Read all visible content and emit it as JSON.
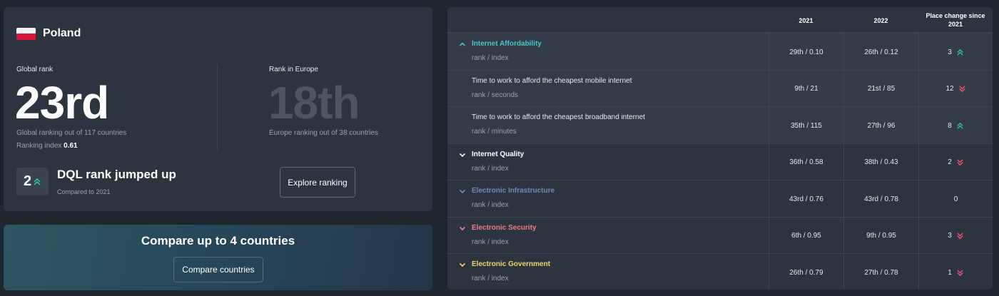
{
  "country": {
    "name": "Poland"
  },
  "global": {
    "label": "Global rank",
    "rank": "23rd",
    "sub": "Global ranking out of 117 countries",
    "index_label": "Ranking index",
    "index_value": "0.61"
  },
  "europe": {
    "label": "Rank in Europe",
    "rank": "18th",
    "sub": "Europe ranking out of 38 countries"
  },
  "jump": {
    "value": "2",
    "title": "DQL rank jumped up",
    "sub": "Compared to 2021",
    "explore_label": "Explore ranking"
  },
  "compare": {
    "title": "Compare up to 4 countries",
    "button_label": "Compare countries"
  },
  "colors": {
    "up": "#2fc28a",
    "down": "#f0506e",
    "affordability": "#4fc3c8",
    "quality": "#ffffff",
    "infrastructure": "#6f8bb5",
    "security": "#f07a8a",
    "government": "#f2d56a"
  },
  "table": {
    "headers": {
      "y2021": "2021",
      "y2022": "2022",
      "change": "Place change since 2021"
    },
    "rows": [
      {
        "name": "Internet Affordability",
        "sub": "rank / index",
        "v2021": "29th / 0.10",
        "v2022": "26th / 0.12",
        "change": "3",
        "dir": "up",
        "category": true,
        "color": "#4fc3c8",
        "chev": "up",
        "highlight": true
      },
      {
        "name": "Time to work to afford the cheapest mobile internet",
        "sub": "rank / seconds",
        "v2021": "9th / 21",
        "v2022": "21st / 85",
        "change": "12",
        "dir": "down",
        "category": false,
        "highlight": true
      },
      {
        "name": "Time to work to afford the cheapest broadband internet",
        "sub": "rank / minutes",
        "v2021": "35th / 115",
        "v2022": "27th / 96",
        "change": "8",
        "dir": "up",
        "category": false,
        "highlight": true
      },
      {
        "name": "Internet Quality",
        "sub": "rank / index",
        "v2021": "36th / 0.58",
        "v2022": "38th / 0.43",
        "change": "2",
        "dir": "down",
        "category": true,
        "color": "#ffffff",
        "chev": "down",
        "highlight": false
      },
      {
        "name": "Electronic Infrastructure",
        "sub": "rank / index",
        "v2021": "43rd / 0.76",
        "v2022": "43rd / 0.78",
        "change": "0",
        "dir": "none",
        "category": true,
        "color": "#6f8bb5",
        "chev": "down",
        "highlight": false
      },
      {
        "name": "Electronic Security",
        "sub": "rank / index",
        "v2021": "6th / 0.95",
        "v2022": "9th / 0.95",
        "change": "3",
        "dir": "down",
        "category": true,
        "color": "#f07a8a",
        "chev": "down",
        "highlight": false
      },
      {
        "name": "Electronic Government",
        "sub": "rank / index",
        "v2021": "26th / 0.79",
        "v2022": "27th / 0.78",
        "change": "1",
        "dir": "down",
        "category": true,
        "color": "#f2d56a",
        "chev": "down",
        "highlight": false
      }
    ]
  }
}
